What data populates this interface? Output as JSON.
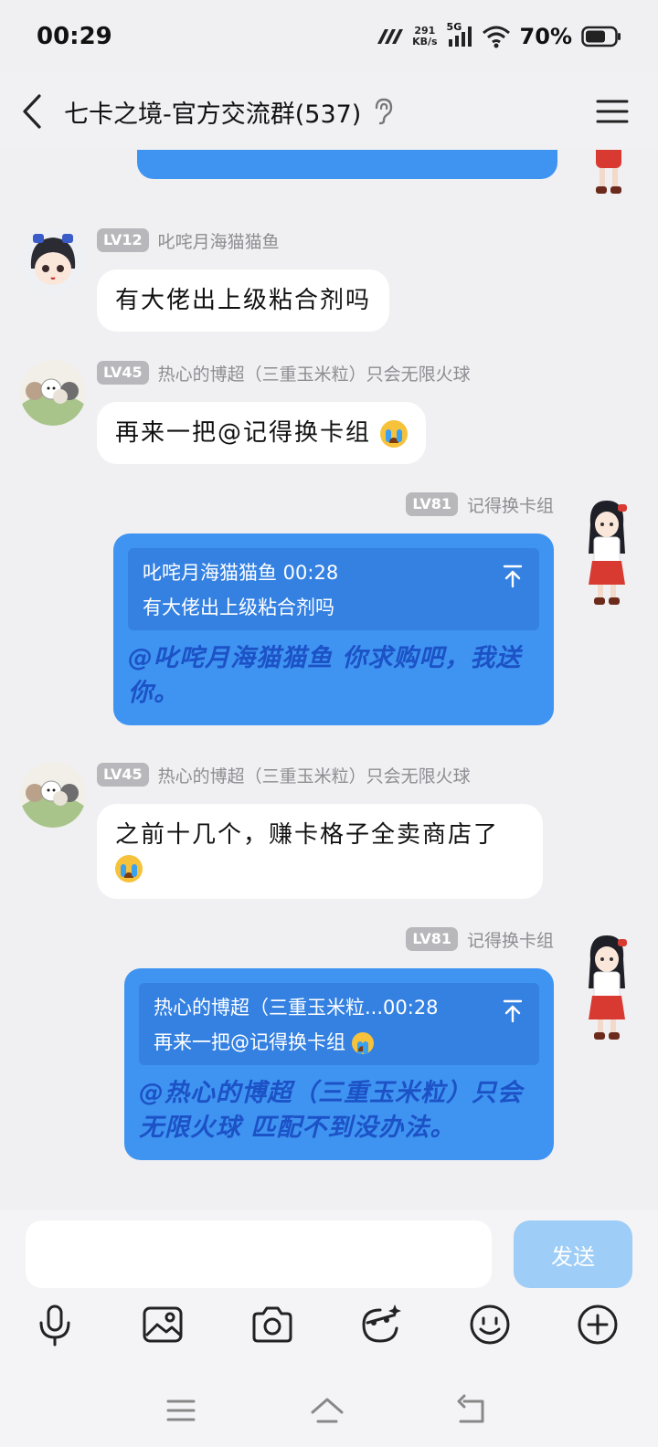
{
  "status_bar": {
    "time": "00:29",
    "net_speed_value": "291",
    "net_speed_unit": "KB/s",
    "network": "5G",
    "battery": "70%",
    "battery_level": 0.7
  },
  "header": {
    "title": "七卡之境-官方交流群(537)"
  },
  "messages": [
    {
      "level": "LV12",
      "nickname": "叱咤月海猫猫鱼",
      "text": "有大佬出上级粘合剂吗"
    },
    {
      "level": "LV45",
      "nickname": "热心的博超（三重玉米粒）只会无限火球",
      "text": "再来一把@记得换卡组"
    },
    {
      "level": "LV81",
      "nickname": "记得换卡组",
      "quote_header": "叱咤月海猫猫鱼 00:28",
      "quote_text": "有大佬出上级粘合剂吗",
      "text": "@叱咤月海猫猫鱼 你求购吧，我送你。"
    },
    {
      "level": "LV45",
      "nickname": "热心的博超（三重玉米粒）只会无限火球",
      "text": "之前十几个，赚卡格子全卖商店了"
    },
    {
      "level": "LV81",
      "nickname": "记得换卡组",
      "quote_header": "热心的博超（三重玉米粒...00:28",
      "quote_text": "再来一把@记得换卡组",
      "text": "@热心的博超（三重玉米粒）只会无限火球 匹配不到没办法。"
    }
  ],
  "input": {
    "placeholder": "",
    "send_label": "发送"
  },
  "toolbar": [
    "microphone-icon",
    "image-icon",
    "camera-icon",
    "sticker-icon",
    "emoji-icon",
    "plus-icon"
  ],
  "colors": {
    "accent": "#3f94f2",
    "reply_text": "#1c52c6",
    "background": "#f0f0f2",
    "send_disabled": "#9ecdf7"
  }
}
